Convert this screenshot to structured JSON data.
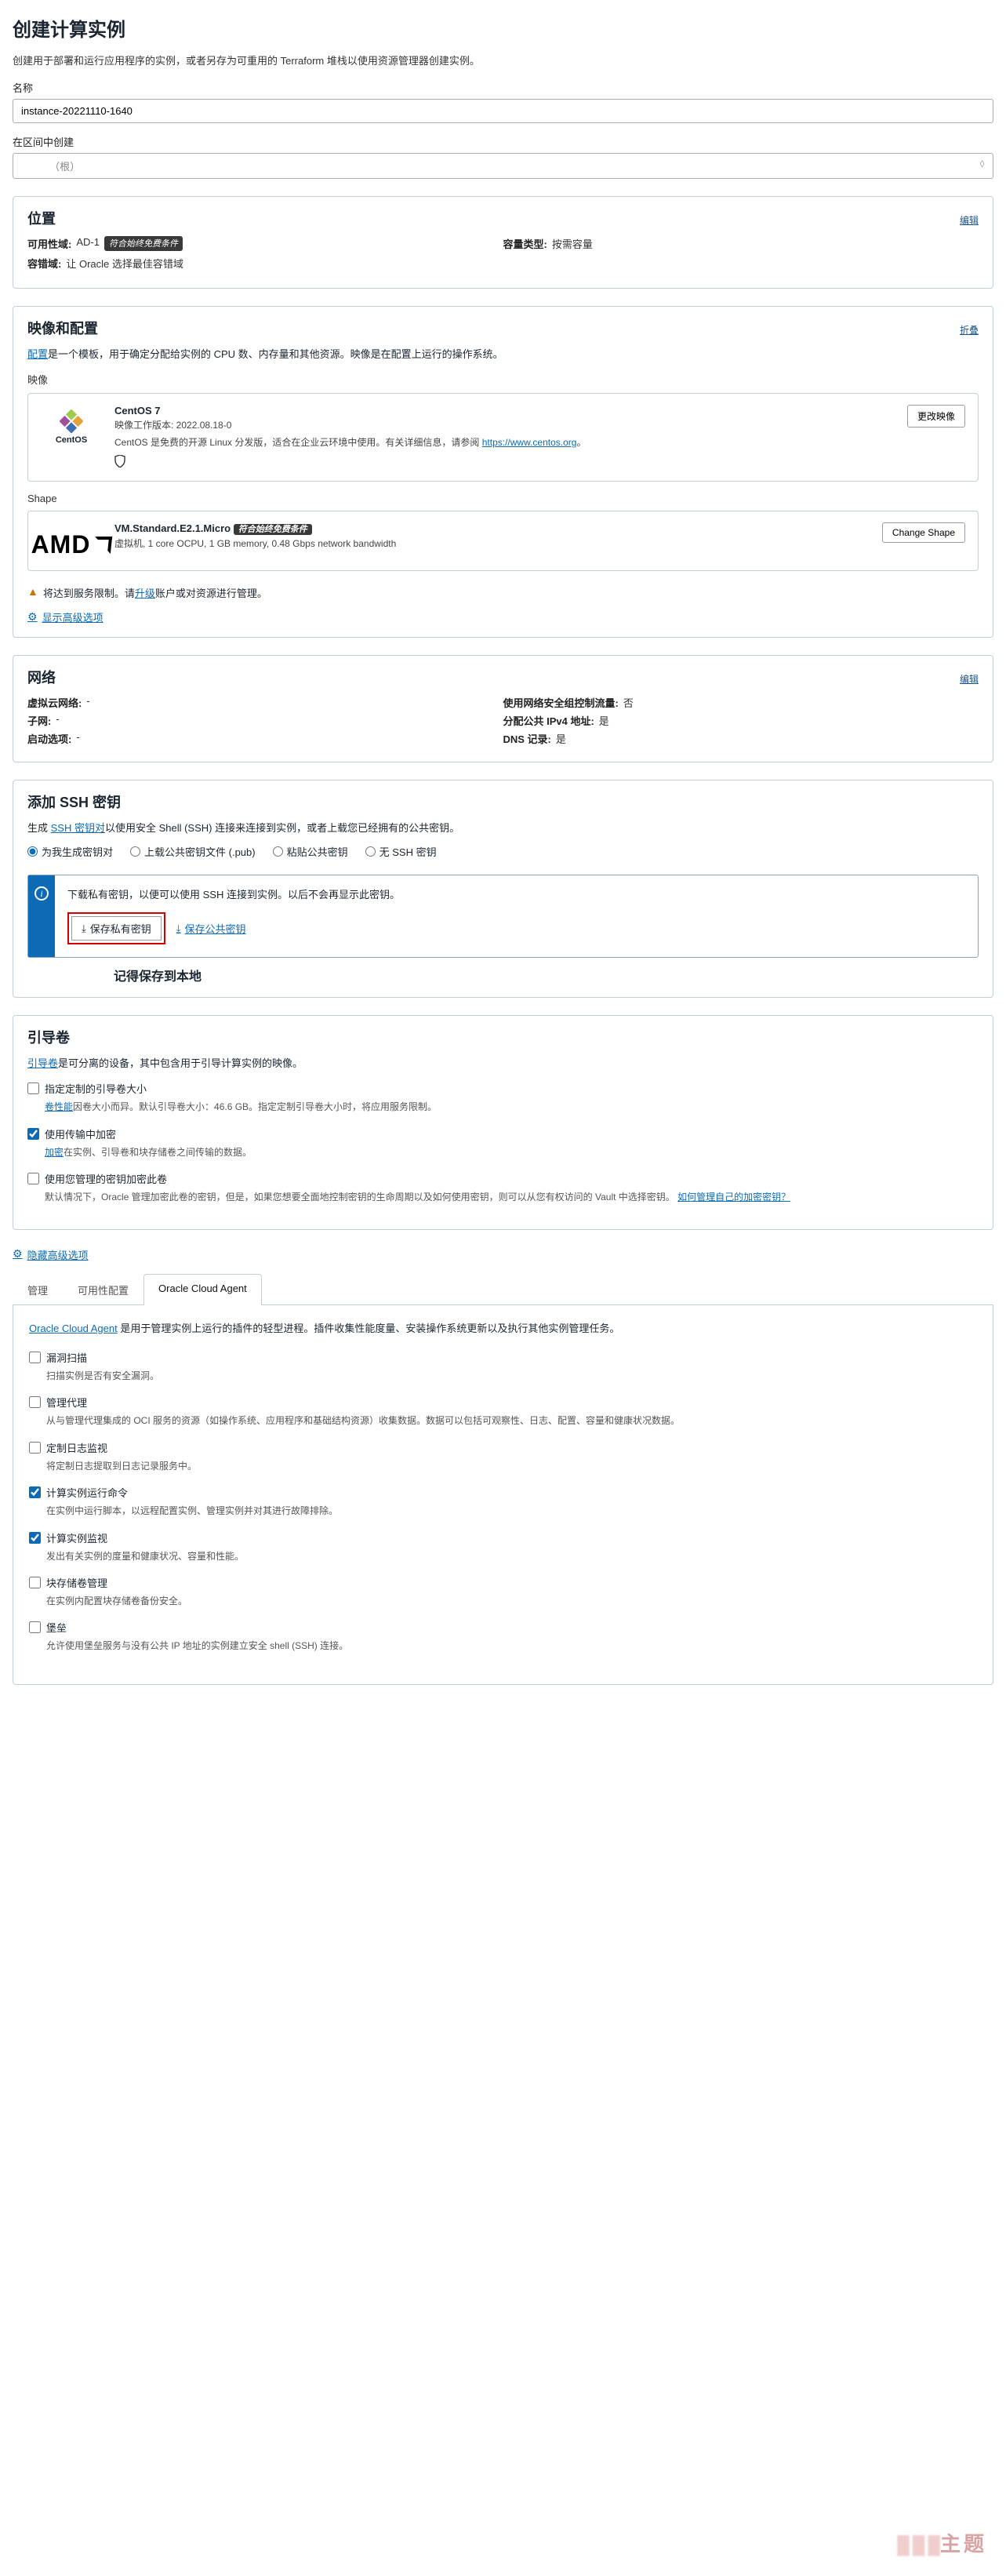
{
  "page": {
    "title": "创建计算实例",
    "lead": "创建用于部署和运行应用程序的实例，或者另存为可重用的 Terraform 堆栈以使用资源管理器创建实例。",
    "name_label": "名称",
    "name_value": "instance-20221110-1640",
    "compartment_label": "在区间中创建",
    "compartment_value": "（根）"
  },
  "location": {
    "title": "位置",
    "edit": "编辑",
    "ad_k": "可用性域:",
    "ad_v": "AD-1",
    "ad_badge": "符合始终免费条件",
    "cap_k": "容量类型:",
    "cap_v": "按需容量",
    "fd_k": "容错域:",
    "fd_v": "让 Oracle 选择最佳容错域"
  },
  "image": {
    "title": "映像和配置",
    "collapse": "折叠",
    "desc_pre": "配置",
    "desc_rest": "是一个模板，用于确定分配给实例的 CPU 数、内存量和其他资源。映像是在配置上运行的操作系统。",
    "img_label": "映像",
    "os_title": "CentOS 7",
    "os_build": "映像工作版本: 2022.08.18-0",
    "os_desc1": "CentOS 是免费的开源 Linux 分发版，适合在企业云环境中使用。有关详细信息，请参阅",
    "os_link": "https://www.centos.org",
    "os_period": "。",
    "change_image": "更改映像",
    "shape_label": "Shape",
    "shape_name": "VM.Standard.E2.1.Micro",
    "shape_badge": "符合始终免费条件",
    "shape_desc": "虚拟机, 1 core OCPU, 1 GB memory, 0.48 Gbps network bandwidth",
    "change_shape": "Change Shape",
    "warn": "将达到服务限制。请",
    "warn_link": "升级",
    "warn_rest": "账户或对资源进行管理。",
    "adv": "显示高级选项"
  },
  "net": {
    "title": "网络",
    "edit": "编辑",
    "rows": [
      {
        "k1": "虚拟云网络:",
        "v1": "-",
        "k2": "使用网络安全组控制流量:",
        "v2": "否"
      },
      {
        "k1": "子网:",
        "v1": "-",
        "k2": "分配公共 IPv4 地址:",
        "v2": "是"
      },
      {
        "k1": "启动选项:",
        "v1": "-",
        "k2": "DNS 记录:",
        "v2": "是"
      }
    ]
  },
  "ssh": {
    "title": "添加 SSH 密钥",
    "desc_pre": "生成 ",
    "desc_link": "SSH 密钥对",
    "desc_rest": "以使用安全 Shell (SSH) 连接来连接到实例，或者上载您已经拥有的公共密钥。",
    "opts": [
      "为我生成密钥对",
      "上载公共密钥文件 (.pub)",
      "粘贴公共密钥",
      "无 SSH 密钥"
    ],
    "info_text": "下载私有密钥，以便可以使用 SSH 连接到实例。以后不会再显示此密钥。",
    "save_priv": "保存私有密钥",
    "save_pub": "保存公共密钥",
    "annotation": "记得保存到本地"
  },
  "boot": {
    "title": "引导卷",
    "desc_link": "引导卷",
    "desc_rest": "是可分离的设备，其中包含用于引导计算实例的映像。",
    "items": [
      {
        "checked": false,
        "label": "指定定制的引导卷大小",
        "help_pre": "",
        "help_link": "卷性能",
        "help_rest": "因卷大小而异。默认引导卷大小：46.6 GB。指定定制引导卷大小时，将应用服务限制。"
      },
      {
        "checked": true,
        "label": "使用传输中加密",
        "help_pre": "",
        "help_link": "加密",
        "help_rest": "在实例、引导卷和块存储卷之间传输的数据。"
      },
      {
        "checked": false,
        "label": "使用您管理的密钥加密此卷",
        "help_pre": "默认情况下，Oracle 管理加密此卷的密钥，但是，如果您想要全面地控制密钥的生命周期以及如何使用密钥，则可以从您有权访问的 Vault 中选择密钥。",
        "help_link": "如何管理自己的加密密钥？",
        "help_rest": ""
      }
    ],
    "hide_adv": "隐藏高级选项"
  },
  "tabs": {
    "list": [
      "管理",
      "可用性配置",
      "Oracle Cloud Agent"
    ],
    "intro_link": "Oracle Cloud Agent",
    "intro_rest": " 是用于管理实例上运行的插件的轻型进程。插件收集性能度量、安装操作系统更新以及执行其他实例管理任务。",
    "items": [
      {
        "checked": false,
        "label": "漏洞扫描",
        "desc": "扫描实例是否有安全漏洞。"
      },
      {
        "checked": false,
        "label": "管理代理",
        "desc": "从与管理代理集成的 OCI 服务的资源（如操作系统、应用程序和基础结构资源）收集数据。数据可以包括可观察性、日志、配置、容量和健康状况数据。"
      },
      {
        "checked": false,
        "label": "定制日志监视",
        "desc": "将定制日志提取到日志记录服务中。"
      },
      {
        "checked": true,
        "label": "计算实例运行命令",
        "desc": "在实例中运行脚本，以远程配置实例、管理实例并对其进行故障排除。"
      },
      {
        "checked": true,
        "label": "计算实例监视",
        "desc": "发出有关实例的度量和健康状况、容量和性能。"
      },
      {
        "checked": false,
        "label": "块存储卷管理",
        "desc": "在实例内配置块存储卷备份安全。"
      },
      {
        "checked": false,
        "label": "堡垒",
        "desc": "允许使用堡垒服务与没有公共 IP 地址的实例建立安全 shell (SSH) 连接。"
      }
    ]
  },
  "watermark": "主题"
}
